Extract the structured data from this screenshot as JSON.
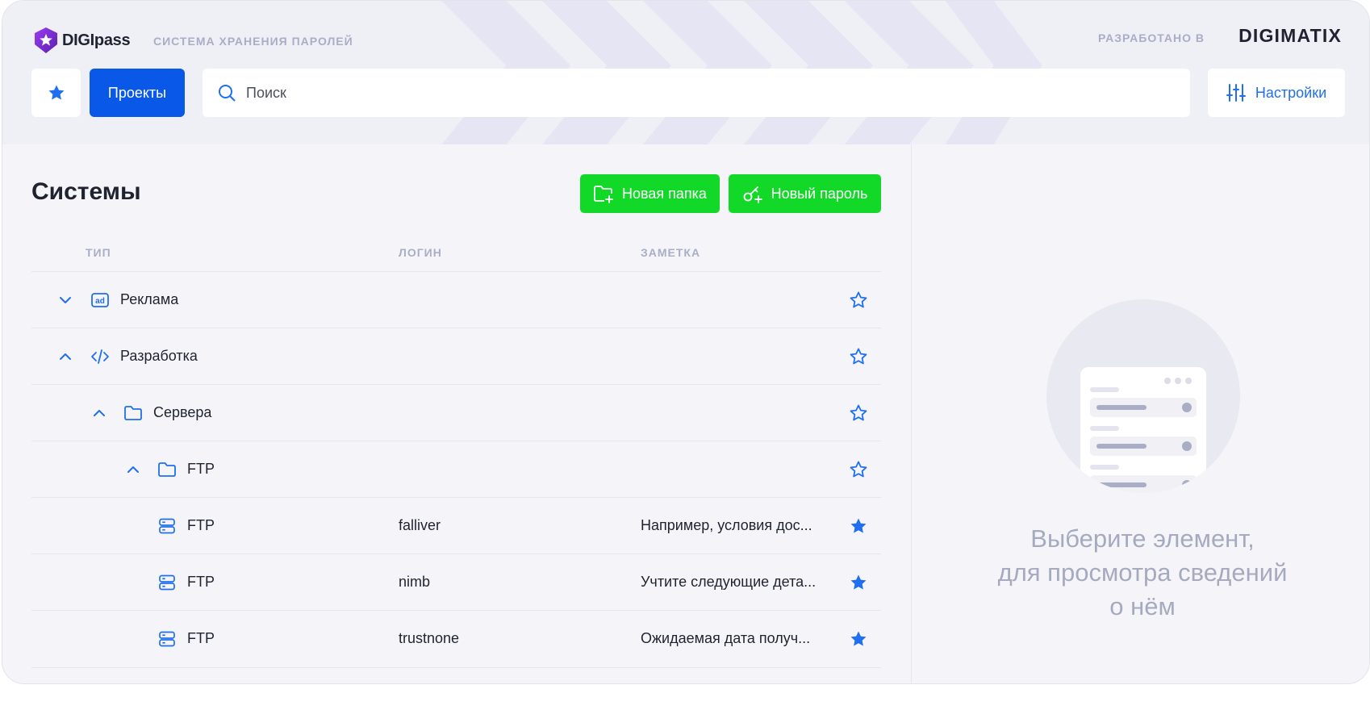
{
  "header": {
    "logo_text": "DIGIpass",
    "subtitle": "СИСТЕМА ХРАНЕНИЯ ПАРОЛЕЙ",
    "developed_by_label": "РАЗРАБОТАНО В",
    "developer_brand": "DIGIMATIX"
  },
  "toolbar": {
    "projects_label": "Проекты",
    "search_placeholder": "Поиск",
    "settings_label": "Настройки"
  },
  "main": {
    "title": "Системы",
    "new_folder_label": "Новая папка",
    "new_password_label": "Новый пароль",
    "columns": [
      "ТИП",
      "ЛОГИН",
      "ЗАМЕТКА"
    ],
    "rows": [
      {
        "name": "Реклама",
        "login": "",
        "note": "",
        "icon": "ad-icon",
        "toggle": "chevron-down-icon",
        "favorite": false
      },
      {
        "name": "Разработка",
        "login": "",
        "note": "",
        "icon": "code-icon",
        "toggle": "chevron-up-icon",
        "favorite": false
      },
      {
        "name": "Сервера",
        "login": "",
        "note": "",
        "icon": "folder-icon",
        "toggle": "chevron-up-icon",
        "favorite": false
      },
      {
        "name": "FTP",
        "login": "",
        "note": "",
        "icon": "folder-icon",
        "toggle": "chevron-up-icon",
        "favorite": false
      },
      {
        "name": "FTP",
        "login": "falliver",
        "note": "Например, условия дос...",
        "icon": "server-icon",
        "toggle": "",
        "favorite": true
      },
      {
        "name": "FTP",
        "login": "nimb",
        "note": "Учтите следующие дета...",
        "icon": "server-icon",
        "toggle": "",
        "favorite": true
      },
      {
        "name": "FTP",
        "login": "trustnone",
        "note": "Ожидаемая дата получ...",
        "icon": "server-icon",
        "toggle": "",
        "favorite": true
      }
    ]
  },
  "details": {
    "empty_line1": "Выберите элемент,",
    "empty_line2": "для просмотра сведений",
    "empty_line3": "о нём"
  },
  "colors": {
    "accent_blue": "#0a58e8",
    "icon_blue": "#1f6ff0",
    "green": "#12d927",
    "brand_purple": "#7b2cbf"
  }
}
